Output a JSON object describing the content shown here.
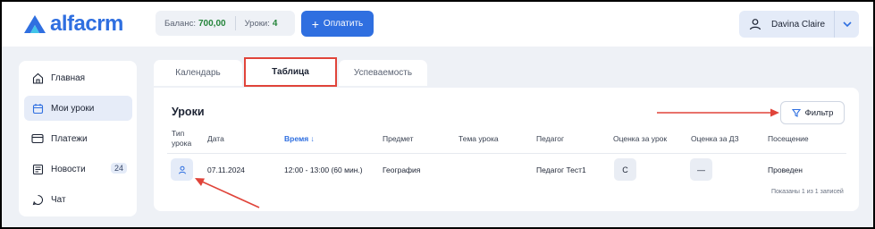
{
  "app": {
    "logo_text": "alfacrm"
  },
  "header": {
    "balance_label": "Баланс:",
    "balance_value": "700,00",
    "lessons_label": "Уроки:",
    "lessons_value": "4",
    "pay_button": "Оплатить",
    "user_name": "Davina Claire"
  },
  "sidebar": {
    "items": [
      {
        "label": "Главная",
        "icon": "home-icon"
      },
      {
        "label": "Мои уроки",
        "icon": "calendar-icon"
      },
      {
        "label": "Платежи",
        "icon": "card-icon"
      },
      {
        "label": "Новости",
        "icon": "news-icon",
        "badge": "24"
      },
      {
        "label": "Чат",
        "icon": "chat-icon"
      }
    ]
  },
  "tabs": [
    "Календарь",
    "Таблица",
    "Успеваемость"
  ],
  "main": {
    "title": "Уроки",
    "filter_button": "Фильтр",
    "columns": {
      "type_line1": "Тип",
      "type_line2": "урока",
      "date": "Дата",
      "time": "Время ↓",
      "subject": "Предмет",
      "topic": "Тема урока",
      "teacher": "Педагог",
      "grade_lesson": "Оценка за урок",
      "grade_hw": "Оценка за ДЗ",
      "attendance": "Посещение"
    },
    "rows": [
      {
        "date": "07.11.2024",
        "time": "12:00 - 13:00 (60 мин.)",
        "subject": "География",
        "topic": "",
        "teacher": "Педагог Тест1",
        "grade_lesson": "C",
        "grade_hw": "—",
        "attendance": "Проведен"
      }
    ],
    "footer": "Показаны 1 из 1 записей"
  },
  "colors": {
    "accent": "#2f6fe0",
    "balance": "#25853b",
    "annotation": "#e0443a"
  }
}
